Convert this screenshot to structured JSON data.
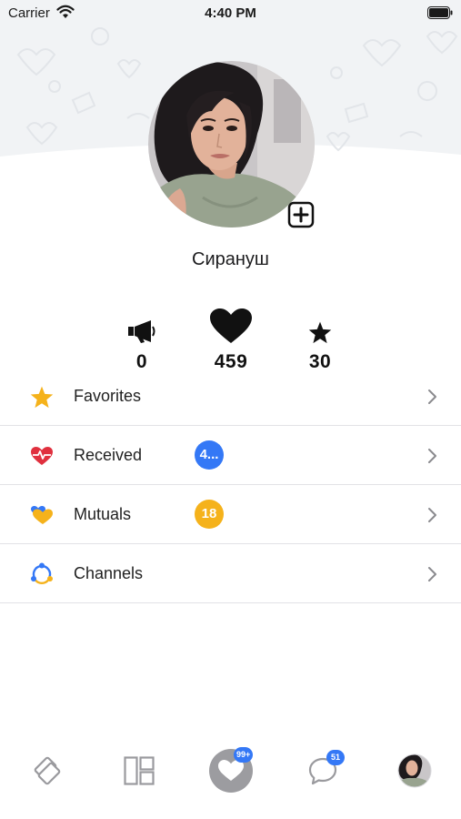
{
  "status_bar": {
    "carrier": "Carrier",
    "time": "4:40 PM"
  },
  "profile": {
    "name": "Сирануш"
  },
  "stats": {
    "ads": "0",
    "likes": "459",
    "stars": "30"
  },
  "menu": {
    "items": [
      {
        "label": "Favorites",
        "icon": "star-icon",
        "badge": ""
      },
      {
        "label": "Received",
        "icon": "heart-pulse-icon",
        "badge": "4..."
      },
      {
        "label": "Mutuals",
        "icon": "mutual-hearts-icon",
        "badge": "18"
      },
      {
        "label": "Channels",
        "icon": "channels-icon",
        "badge": ""
      }
    ]
  },
  "tabbar": {
    "likes_badge": "99+",
    "messages_badge": "51"
  },
  "colors": {
    "accent_blue": "#3478f6",
    "accent_yellow": "#f5b21b",
    "heart_red": "#e0303e",
    "chevron": "#8a8a8e"
  }
}
